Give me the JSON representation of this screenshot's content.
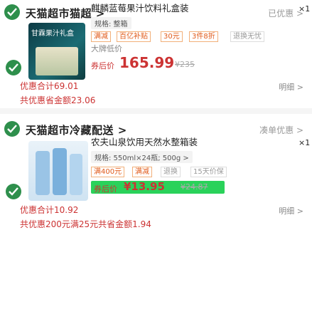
{
  "store1": {
    "name": "天猫超市猫超 >",
    "status": "已优惠 >",
    "item": {
      "title": "麒麟蓝莓果汁饮料礼盒装",
      "qty": "×1",
      "spec": "规格: 整箱",
      "tags": [
        "满减",
        "百亿补贴",
        "30元",
        "3件8折",
        "退换无忧"
      ],
      "sub_line": "大牌低价",
      "badge": "券后价",
      "price": "165.99",
      "price_strike": "¥235",
      "estimate": "优惠合计69.01",
      "detail": "明细 >",
      "promo": "共优惠省金额23.06",
      "thumb_brand": "甘霖果汁礼盒"
    }
  },
  "store2": {
    "name": "天猫超市冷藏配送 >",
    "status": "凑单优惠 >",
    "item": {
      "title": "农夫山泉饮用天然水整箱装",
      "qty": "×1",
      "spec": "规格: 550ml×24瓶; 500g >",
      "tags": [
        "满400元",
        "满减",
        "退换",
        "15天价保"
      ],
      "badge": "券后价",
      "price": "¥13.95",
      "price_strike": "¥24.87",
      "estimate": "优惠合计10.92",
      "detail": "明细 >",
      "promo": "共优惠200元满25元共省金额1.94"
    }
  },
  "colors": {
    "accent": "#2e8f4c",
    "price": "#cc3333",
    "tag": "#e05a1a"
  }
}
